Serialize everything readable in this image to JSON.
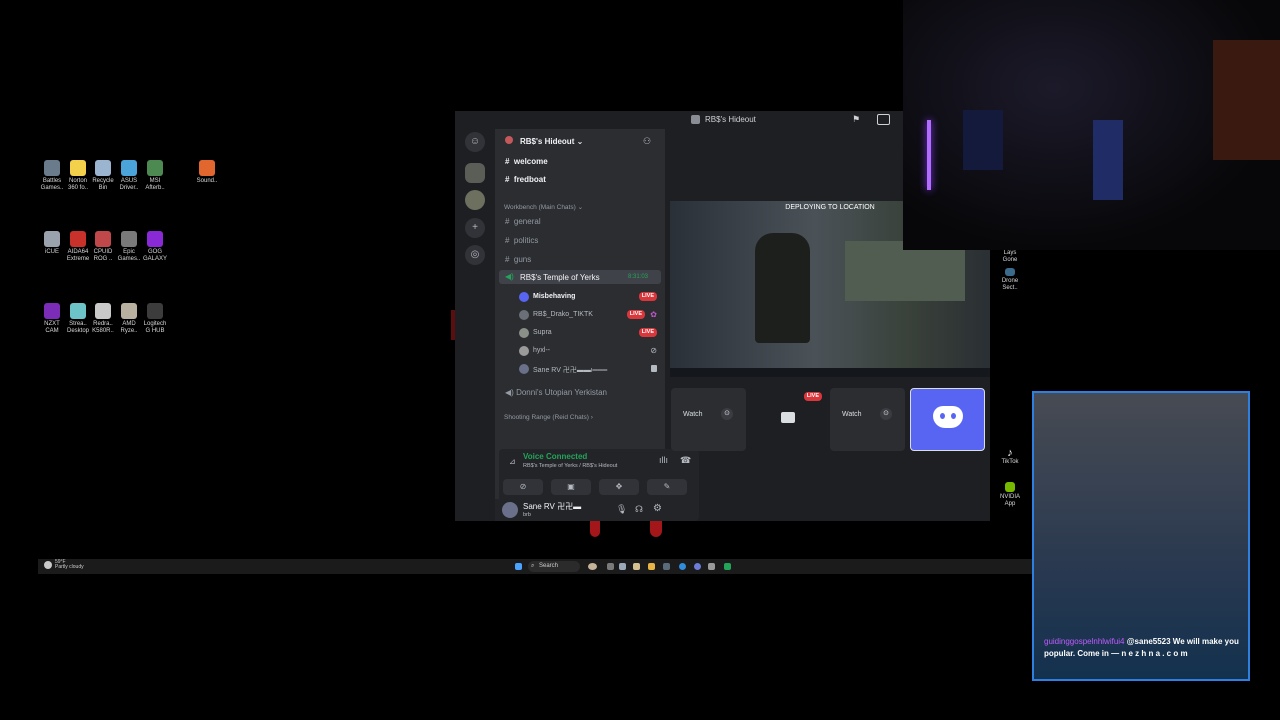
{
  "desktop": {
    "icons": [
      {
        "label": "Battles Games..",
        "color": "#6a7b8c"
      },
      {
        "label": "Norton 360 fo..",
        "color": "#f3d14a"
      },
      {
        "label": "Recycle Bin",
        "color": "#9bb4cf"
      },
      {
        "label": "ASUS Driver..",
        "color": "#4aa3d9"
      },
      {
        "label": "MSI Afterb..",
        "color": "#4d8a52"
      },
      {
        "label": "Sound..",
        "color": "#e2672e"
      },
      {
        "label": "iCUE",
        "color": "#9aa2ad"
      },
      {
        "label": "AIDA64 Extreme",
        "color": "#c8322b"
      },
      {
        "label": "CPUID ROG ..",
        "color": "#c0474a"
      },
      {
        "label": "Epic Games..",
        "color": "#7a7a7a"
      },
      {
        "label": "GOG GALAXY",
        "color": "#8a2ad6"
      },
      {
        "label": "NZXT CAM",
        "color": "#7b2db8"
      },
      {
        "label": "Strea.. Desktop",
        "color": "#6cc4c8"
      },
      {
        "label": "Redra.. K580R..",
        "color": "#c9c9c9"
      },
      {
        "label": "AMD Ryze..",
        "color": "#b9b0a0"
      },
      {
        "label": "Logitech G HUB",
        "color": "#3c3c3c"
      }
    ],
    "right_icons": [
      {
        "label": "Lays Gone"
      },
      {
        "label": "Drone Sect.."
      },
      {
        "label": "TikTok"
      },
      {
        "label": "NVIDIA App"
      }
    ]
  },
  "taskbar": {
    "weather_temp": "59°F",
    "weather_desc": "Partly cloudy",
    "search_label": "Search"
  },
  "discord": {
    "window_title": "RB$'s Hideout",
    "server_name": "RB$'s Hideout",
    "top_channels": [
      "welcome",
      "fredboat"
    ],
    "category_main": "Workbench (Main Chats)",
    "text_channels": [
      "general",
      "politics",
      "guns"
    ],
    "voice_channel_active": "RB$'s Temple of Yerks",
    "voice_timer": "8:31:03",
    "voice_users": [
      {
        "name": "Misbehaving",
        "live": "LIVE"
      },
      {
        "name": "RB$_Drako_TIKTK",
        "live": "LIVE"
      },
      {
        "name": "Supra",
        "live": "LIVE"
      },
      {
        "name": "hyxl--",
        "live": ""
      },
      {
        "name": "Sane RV 卍卍▬▬ι═══",
        "live": ""
      }
    ],
    "voice_channel_2": "Donni's Utopian Yerkistan",
    "category_2": "Shooting Range (Reid Chats)",
    "vc_status": "Voice Connected",
    "vc_location": "RB$'s Temple of Yerks / RB$'s Hideout",
    "user_name": "Sane RV 卍卍▬",
    "user_status": "brb",
    "stream_title": "DEPLOYING TO LOCATION",
    "tiles": [
      {
        "label": "Watch",
        "type": "watch"
      },
      {
        "label": "LIVE",
        "type": "live"
      },
      {
        "label": "Watch",
        "type": "watch"
      },
      {
        "label": "",
        "type": "discord"
      }
    ]
  },
  "chat": {
    "username": "guidinggospelnhlwifui4",
    "message": "@sane5523 We will make you popular. Come in — n e z h n a . c o m"
  }
}
